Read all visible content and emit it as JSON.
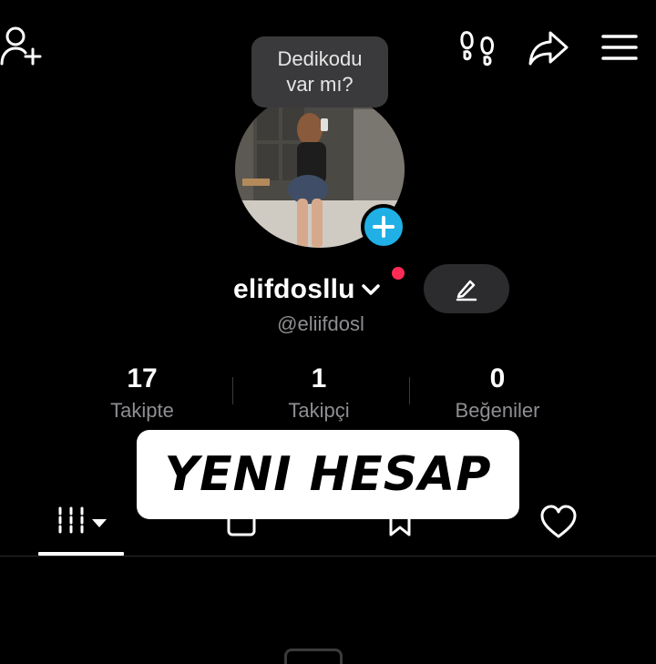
{
  "header": {
    "icons": [
      "add-friend-icon",
      "footprint-icon",
      "share-icon",
      "menu-icon"
    ]
  },
  "note": {
    "text": "Dedikodu\nvar mı?"
  },
  "profile": {
    "display_name": "elifdosllu",
    "handle": "@eliifdosl",
    "accent_color": "#20b0e6",
    "notification_color": "#fe2c55"
  },
  "stats": [
    {
      "value": "17",
      "label": "Takipte"
    },
    {
      "value": "1",
      "label": "Takipçi"
    },
    {
      "value": "0",
      "label": "Beğeniler"
    }
  ],
  "tabs": [
    "videos-grid-icon",
    "private-icon",
    "saved-icon",
    "liked-icon"
  ],
  "banner": {
    "text": "YENI HESAP"
  }
}
